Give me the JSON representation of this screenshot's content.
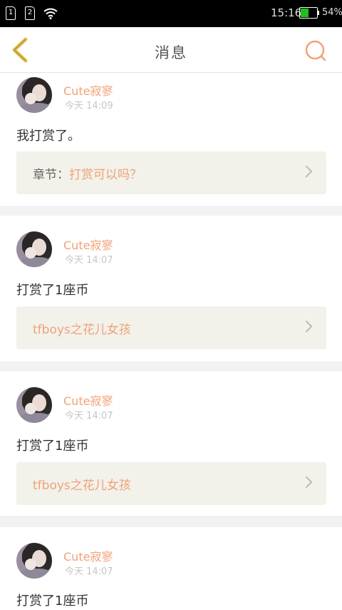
{
  "status_bar": {
    "sim1": "1",
    "sim2": "2",
    "time": "15:16",
    "battery_percent": "54%",
    "battery_level": 0.54
  },
  "header": {
    "title": "消息"
  },
  "messages": [
    {
      "user": "Cute寂寥",
      "time": "今天 14:09",
      "text": "我打赏了。",
      "link_prefix": "章节：",
      "link_text": "打赏可以吗？"
    },
    {
      "user": "Cute寂寥",
      "time": "今天 14:07",
      "text": "打赏了1座币",
      "link_prefix": "",
      "link_text": "tfboys之花儿女孩"
    },
    {
      "user": "Cute寂寥",
      "time": "今天 14:07",
      "text": "打赏了1座币",
      "link_prefix": "",
      "link_text": "tfboys之花儿女孩"
    },
    {
      "user": "Cute寂寥",
      "time": "今天 14:07",
      "text": "打赏了1座币",
      "link_prefix": "",
      "link_text": ""
    }
  ],
  "colors": {
    "accent": "#f0a277",
    "back_arrow": "#e8c24a",
    "battery": "#1fbf1f",
    "link_bg": "#f2f1ea"
  }
}
